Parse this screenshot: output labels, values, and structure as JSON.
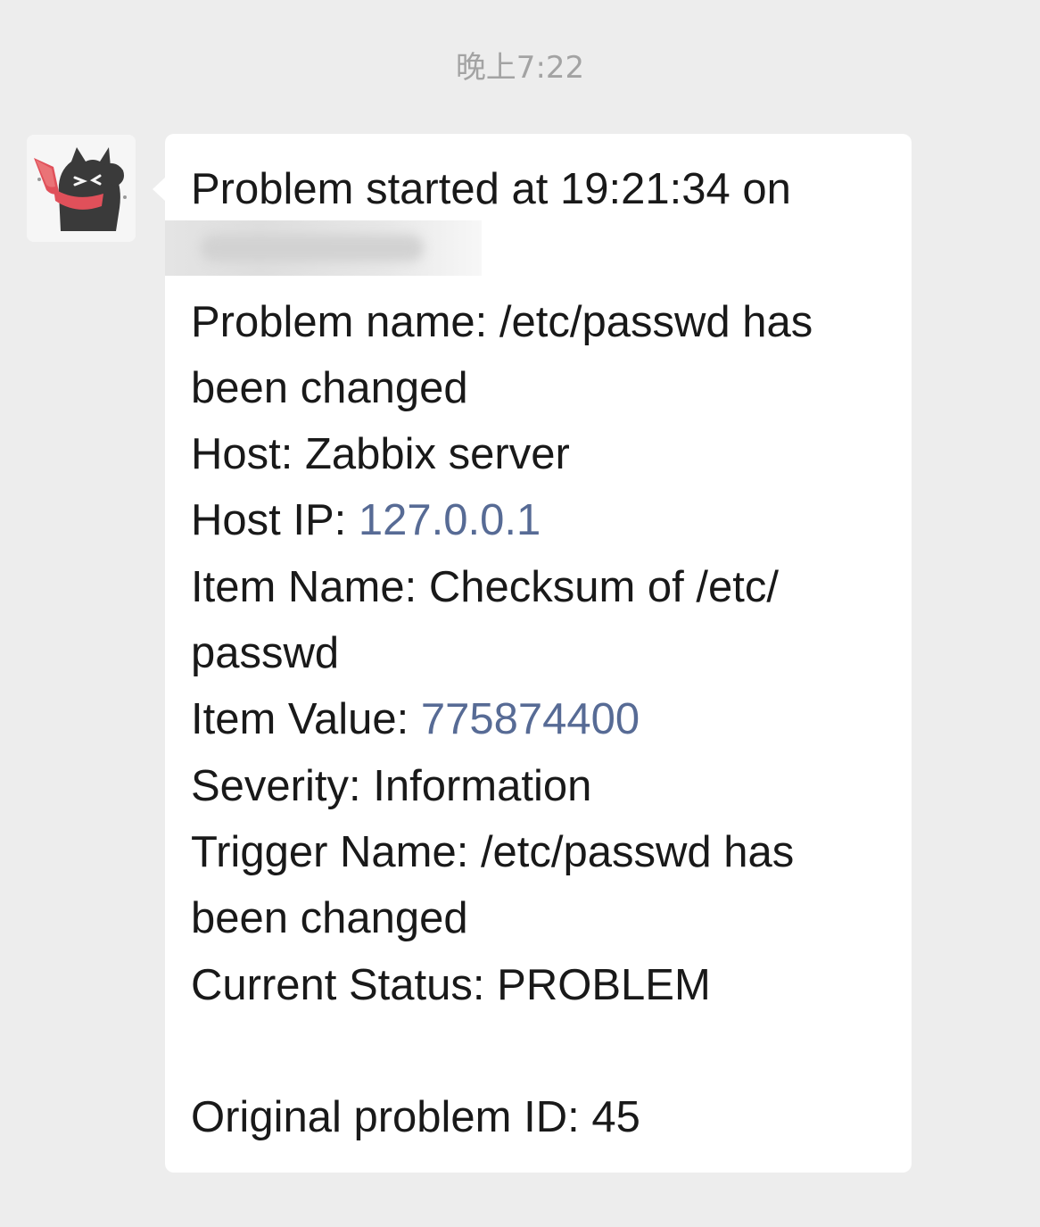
{
  "timestamp": "晚上7:22",
  "message": {
    "line_1": "Problem started at 19:21:34 on",
    "problem_name_label": "Problem name: ",
    "problem_name_value_1": "/etc/passwd has",
    "problem_name_value_2": "been changed",
    "host_label": "Host: ",
    "host_value": "Zabbix server",
    "host_ip_label": "Host IP: ",
    "host_ip_value": "127.0.0.1",
    "item_name_label": "Item Name: ",
    "item_name_value_1": "Checksum of /etc/",
    "item_name_value_2": "passwd",
    "item_value_label": "Item Value: ",
    "item_value_value": "775874400",
    "severity_label": "Severity: ",
    "severity_value": "Information",
    "trigger_name_label": "Trigger Name: ",
    "trigger_name_value_1": "/etc/passwd has",
    "trigger_name_value_2": "been changed",
    "status_label": "Current Status: ",
    "status_value": "PROBLEM",
    "original_id_label": "Original problem ID: ",
    "original_id_value": "45"
  },
  "colors": {
    "background": "#ededed",
    "bubble": "#ffffff",
    "text": "#191919",
    "link": "#576b95",
    "timestamp": "#a3a3a3"
  },
  "icons": {
    "avatar": "cartoon-cat-avatar"
  }
}
